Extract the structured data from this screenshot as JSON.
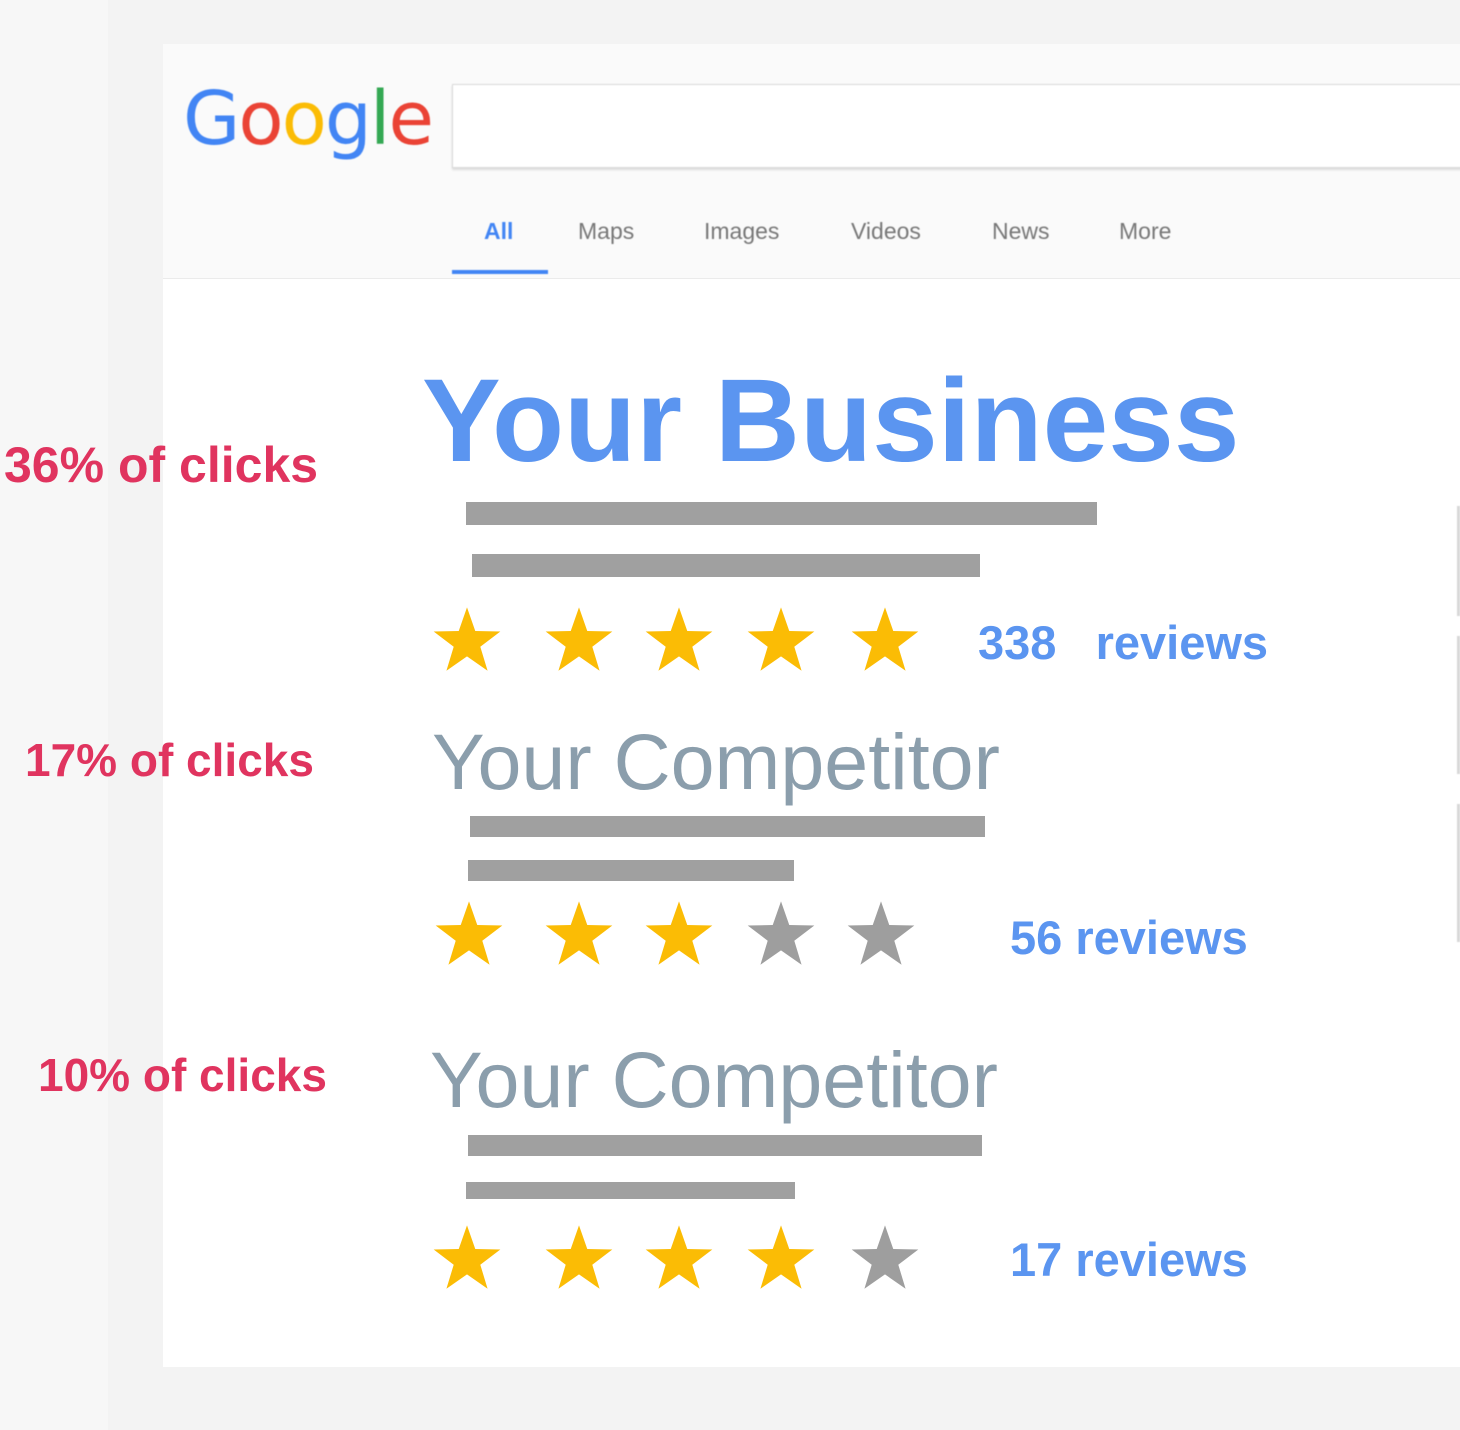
{
  "logo": {
    "letters": [
      {
        "char": "G",
        "color": "#4285f4"
      },
      {
        "char": "o",
        "color": "#ea4335"
      },
      {
        "char": "o",
        "color": "#fbbc05"
      },
      {
        "char": "g",
        "color": "#4285f4"
      },
      {
        "char": "l",
        "color": "#34a853"
      },
      {
        "char": "e",
        "color": "#ea4335"
      }
    ]
  },
  "search": {
    "value": ""
  },
  "tabs": [
    {
      "label": "All",
      "active": true
    },
    {
      "label": "Maps",
      "active": false
    },
    {
      "label": "Images",
      "active": false
    },
    {
      "label": "Videos",
      "active": false
    },
    {
      "label": "News",
      "active": false
    },
    {
      "label": "More",
      "active": false
    }
  ],
  "results": [
    {
      "click_share": "36% of clicks",
      "title": "Your Business",
      "rating": 5,
      "reviews": "338   reviews"
    },
    {
      "click_share": "17% of clicks",
      "title": "Your Competitor",
      "rating": 3,
      "reviews": "56 reviews"
    },
    {
      "click_share": "10% of clicks",
      "title": "Your Competitor",
      "rating": 4,
      "reviews": "17 reviews"
    }
  ],
  "colors": {
    "accent_blue": "#5b95f0",
    "click_label": "#e0345f",
    "star_filled": "#fbbc05",
    "star_empty": "#9e9e9e"
  }
}
